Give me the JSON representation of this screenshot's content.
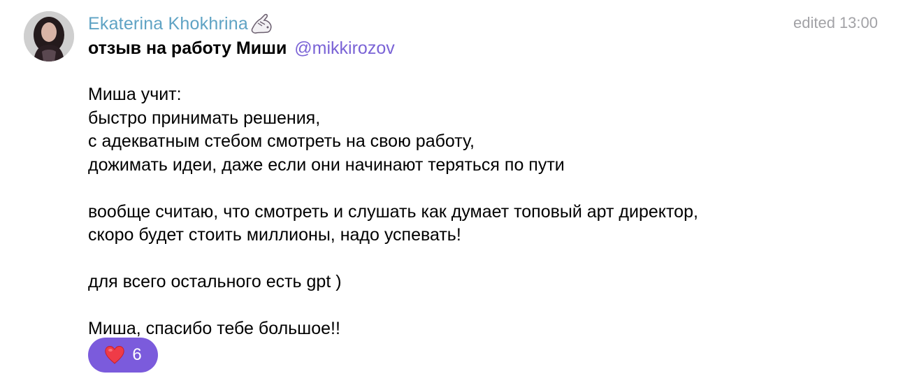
{
  "message": {
    "author": {
      "name": "Ekaterina Khokhrina",
      "avatar_icon": "avatar-photo",
      "status_emoji_icon": "pointing-hand-sticker-icon",
      "name_color": "#5fa3c4"
    },
    "edited_label": "edited",
    "time": "13:00",
    "title": "отзыв на работу Миши",
    "mention": "@mikkirozov",
    "mention_color": "#7a63d6",
    "paragraphs": [
      [
        "Миша учит:",
        "быстро принимать решения,",
        "с адекватным стебом смотреть на свою работу,",
        "дожимать идеи, даже если они начинают теряться по пути"
      ],
      [
        "вообще считаю, что смотреть и слушать как думает топовый арт директор,",
        "скоро будет стоить миллионы, надо успевать!"
      ],
      [
        "для всего остального есть gpt )"
      ],
      [
        "Миша, спасибо тебе большое!!"
      ]
    ],
    "reaction": {
      "icon": "heart-icon",
      "count": "6",
      "color": "#7b5bdc"
    }
  }
}
